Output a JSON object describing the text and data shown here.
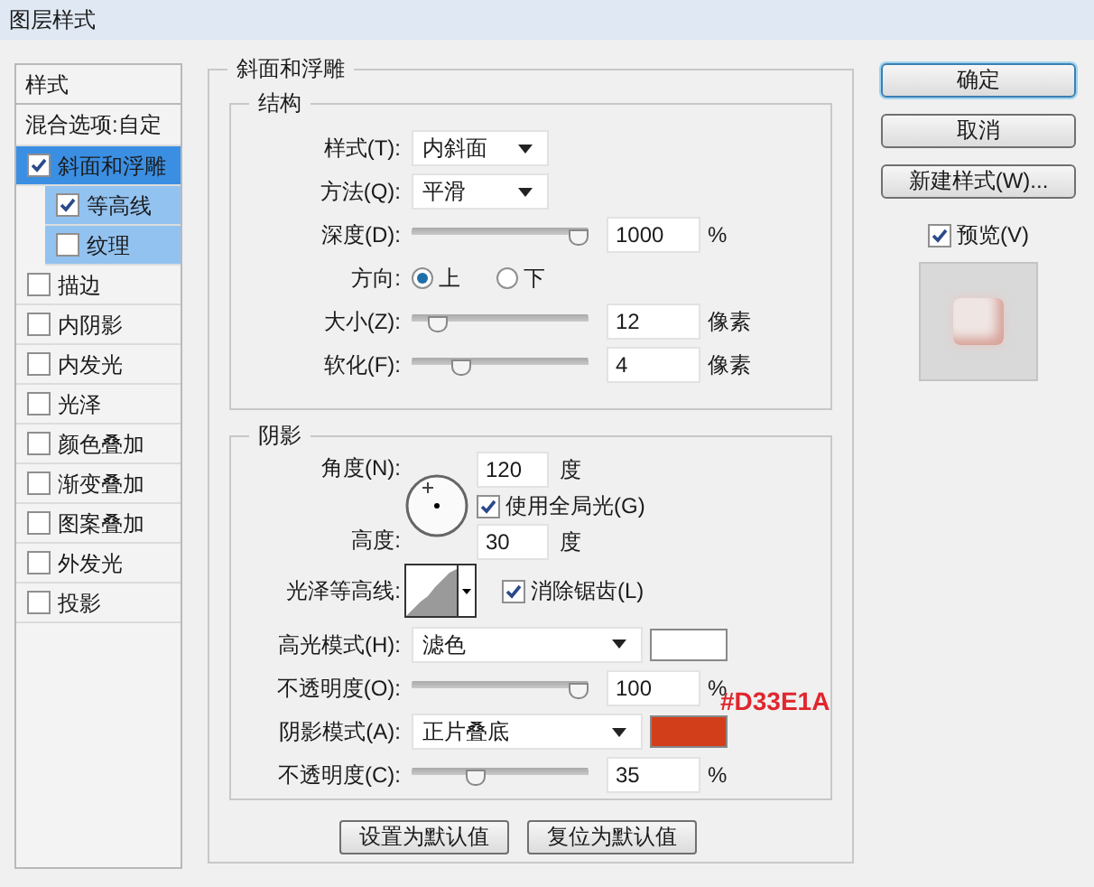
{
  "window": {
    "title": "图层样式"
  },
  "styles_list": {
    "header": "样式",
    "blending_options": "混合选项:自定",
    "items": [
      {
        "label": "斜面和浮雕",
        "checked": true,
        "selected": true,
        "children": [
          {
            "label": "等高线",
            "checked": true,
            "selected": false
          },
          {
            "label": "纹理",
            "checked": false,
            "selected": false
          }
        ]
      },
      {
        "label": "描边",
        "checked": false,
        "selected": false
      },
      {
        "label": "内阴影",
        "checked": false,
        "selected": false
      },
      {
        "label": "内发光",
        "checked": false,
        "selected": false
      },
      {
        "label": "光泽",
        "checked": false,
        "selected": false
      },
      {
        "label": "颜色叠加",
        "checked": false,
        "selected": false
      },
      {
        "label": "渐变叠加",
        "checked": false,
        "selected": false
      },
      {
        "label": "图案叠加",
        "checked": false,
        "selected": false
      },
      {
        "label": "外发光",
        "checked": false,
        "selected": false
      },
      {
        "label": "投影",
        "checked": false,
        "selected": false
      }
    ]
  },
  "panel": {
    "title": "斜面和浮雕",
    "structure": {
      "title": "结构",
      "style": {
        "label": "样式(T):",
        "value": "内斜面"
      },
      "technique": {
        "label": "方法(Q):",
        "value": "平滑"
      },
      "depth": {
        "label": "深度(D):",
        "level": 1.0,
        "value": "1000",
        "unit": "%"
      },
      "direction": {
        "label": "方向:",
        "options": [
          {
            "label": "上",
            "selected": true
          },
          {
            "label": "下",
            "selected": false
          }
        ]
      },
      "size": {
        "label": "大小(Z):",
        "level": 0.1,
        "value": "12",
        "unit": "像素"
      },
      "soften": {
        "label": "软化(F):",
        "level": 0.25,
        "value": "4",
        "unit": "像素"
      }
    },
    "shading": {
      "title": "阴影",
      "angle": {
        "label": "角度(N):",
        "value": "120",
        "unit": "度"
      },
      "use_global_light": {
        "label": "使用全局光(G)",
        "checked": true
      },
      "altitude": {
        "label": "高度:",
        "value": "30",
        "unit": "度"
      },
      "gloss_contour": {
        "label": "光泽等高线:"
      },
      "anti_aliased": {
        "label": "消除锯齿(L)",
        "checked": true
      },
      "highlight_mode": {
        "label": "高光模式(H):",
        "value": "滤色",
        "color": "#ffffff"
      },
      "highlight_opacity": {
        "label": "不透明度(O):",
        "level": 1.0,
        "value": "100",
        "unit": "%"
      },
      "shadow_mode": {
        "label": "阴影模式(A):",
        "value": "正片叠底",
        "color": "#d33e1a"
      },
      "shadow_opacity": {
        "label": "不透明度(C):",
        "level": 0.35,
        "value": "35",
        "unit": "%"
      },
      "annotation": "#D33E1A"
    },
    "buttons": [
      "设置为默认值",
      "复位为默认值"
    ]
  },
  "actions": [
    {
      "label": "确定",
      "primary": true
    },
    {
      "label": "取消",
      "primary": false
    },
    {
      "label": "新建样式(W)...",
      "primary": false
    }
  ],
  "preview": {
    "label": "预览(V)",
    "checked": true
  }
}
